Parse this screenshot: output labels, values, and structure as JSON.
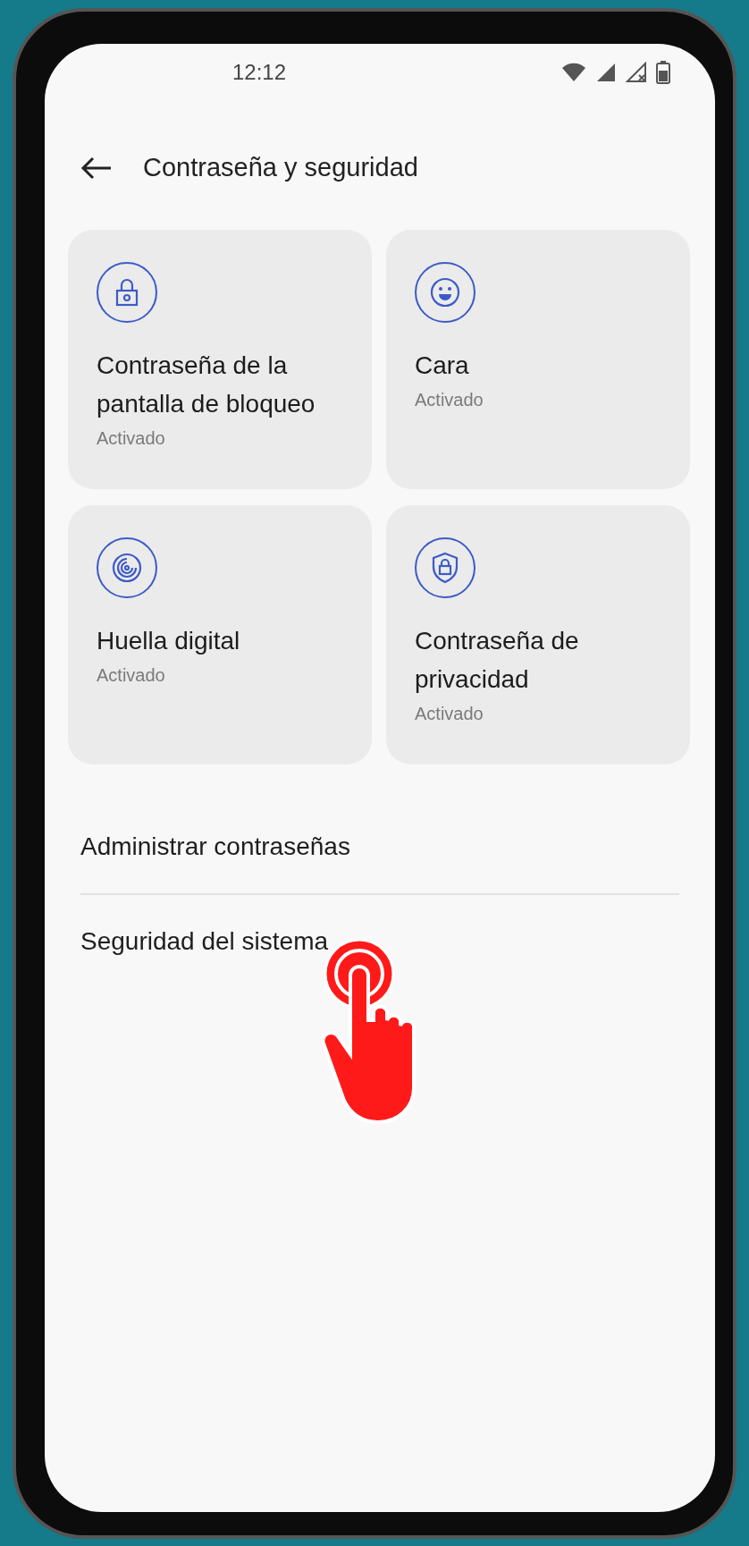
{
  "status_bar": {
    "time": "12:12"
  },
  "header": {
    "title": "Contraseña y seguridad"
  },
  "cards": [
    {
      "kind": "lock",
      "title": "Contraseña de la pantalla de bloqueo",
      "status": "Activado"
    },
    {
      "kind": "face",
      "title": "Cara",
      "status": "Activado"
    },
    {
      "kind": "fingerprint",
      "title": "Huella digital",
      "status": "Activado"
    },
    {
      "kind": "shield",
      "title": "Contraseña de privacidad",
      "status": "Activado"
    }
  ],
  "list": [
    {
      "label": "Administrar contraseñas"
    },
    {
      "label": "Seguridad del sistema",
      "tapped": true
    }
  ]
}
